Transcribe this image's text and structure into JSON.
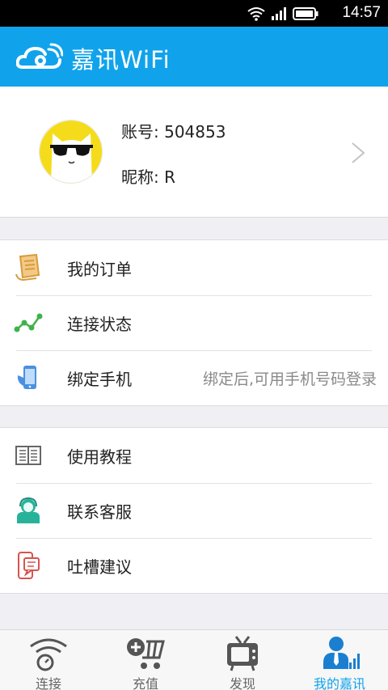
{
  "status_bar": {
    "time": "14:57"
  },
  "app_bar": {
    "title": "嘉讯WiFi"
  },
  "profile": {
    "account": "账号: 504853",
    "nickname": "昵称: R"
  },
  "menu_group_1": [
    {
      "label": "我的订单",
      "icon": "order-receipt-icon"
    },
    {
      "label": "连接状态",
      "icon": "connection-status-icon"
    },
    {
      "label": "绑定手机",
      "icon": "bind-phone-icon",
      "hint": "绑定后,可用手机号码登录"
    }
  ],
  "menu_group_2": [
    {
      "label": "使用教程",
      "icon": "tutorial-book-icon"
    },
    {
      "label": "联系客服",
      "icon": "customer-service-icon"
    },
    {
      "label": "吐槽建议",
      "icon": "feedback-icon"
    }
  ],
  "tabs": [
    {
      "label": "连接",
      "icon": "wifi-connect-icon",
      "active": false
    },
    {
      "label": "充值",
      "icon": "recharge-cart-icon",
      "active": false
    },
    {
      "label": "发现",
      "icon": "discover-tv-icon",
      "active": false
    },
    {
      "label": "我的嘉讯",
      "icon": "my-account-icon",
      "active": true
    }
  ],
  "colors": {
    "brand": "#10a3ec",
    "background": "#efeff4"
  }
}
